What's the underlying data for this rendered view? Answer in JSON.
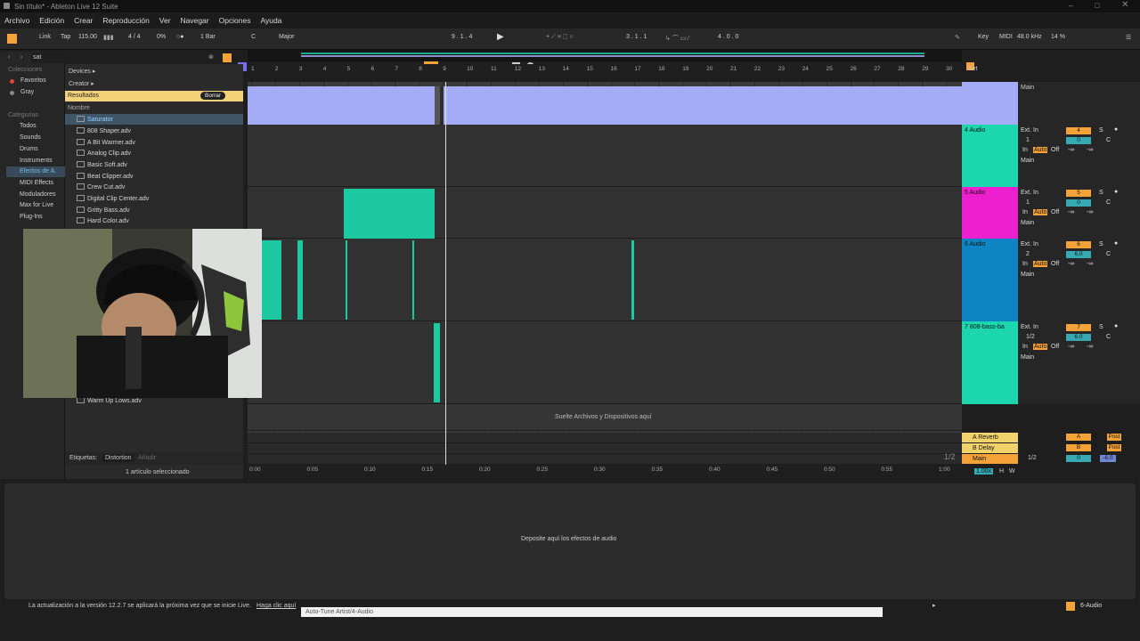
{
  "window": {
    "title": "Sin título* - Ableton Live 12 Suite"
  },
  "menu": [
    "Archivo",
    "Edición",
    "Crear",
    "Reproducción",
    "Ver",
    "Navegar",
    "Opciones",
    "Ayuda"
  ],
  "transport": {
    "link": "Link",
    "tap": "Tap",
    "tempo": "115.00",
    "signature": "4 / 4",
    "metro_pct": "0%",
    "quant": "1 Bar",
    "key": "C",
    "scale": "Major",
    "position": "9 .  1 .  4",
    "loop_start": "3 .  1 .  1",
    "loop_len": "4 .  0 .  0",
    "key_label": "Key",
    "midi_label": "MIDI",
    "sample_rate": "48.0 kHz",
    "cpu": "14 %"
  },
  "browser": {
    "search": "sat",
    "collections_header": "Colecciones",
    "collections": [
      "Favoritos",
      "Gray"
    ],
    "categories_header": "Categorías",
    "categories": [
      "Todos",
      "Sounds",
      "Drums",
      "Instruments",
      "Efectos de A.",
      "MIDI Effects",
      "Moduladores",
      "Max for Live",
      "Plug-Ins"
    ],
    "devices": "Devices ▸",
    "creator": "Creator ▸",
    "results_label": "Resultados",
    "clear_label": "Borrar",
    "name_header": "Nombre",
    "results": [
      "Saturator",
      "808 Shaper.adv",
      "A Bit Warmer.adv",
      "Analog Clip.adv",
      "Basic Soft.adv",
      "Beat Clipper.adv",
      "Crew Cut.adv",
      "Digital Clip Center.adv",
      "Gritty Bass.adv",
      "Hard Color.adv"
    ],
    "last_result": "Warm Up Lows.adv",
    "tags_label": "Etiquetas:",
    "tag": "Distortion",
    "add_tag": "Añadir",
    "selection_info": "1 artículo seleccionado"
  },
  "ruler": [
    "1",
    "2",
    "3",
    "4",
    "5",
    "6",
    "7",
    "8",
    "9",
    "10",
    "11",
    "12",
    "13",
    "14",
    "15",
    "16",
    "17",
    "18",
    "19",
    "20",
    "21",
    "22",
    "23",
    "24",
    "25",
    "26",
    "27",
    "28",
    "29",
    "30"
  ],
  "time_ruler": [
    "0:00",
    "0:05",
    "0:10",
    "0:15",
    "0:20",
    "0:25",
    "0:30",
    "0:35",
    "0:40",
    "0:45",
    "0:50",
    "0:55",
    "1:00"
  ],
  "set_label": "Set",
  "tracks": [
    {
      "name": "4 Audio",
      "color": "#1cd6ae",
      "input": "Ext. In",
      "ch": "1",
      "num": "4",
      "vol": "0",
      "pan": "C"
    },
    {
      "name": "5 Audio",
      "color": "#ee1fcf",
      "input": "Ext. In",
      "ch": "1",
      "num": "5",
      "vol": "0",
      "pan": "C"
    },
    {
      "name": "6 Audio",
      "color": "#0e85c2",
      "input": "Ext. In",
      "ch": "2",
      "num": "6",
      "vol": "6.0",
      "pan": "C"
    },
    {
      "name": "7 808-bass-ba",
      "color": "#1cd6ae",
      "input": "Ext. In",
      "ch": "1/2",
      "num": "7",
      "vol": "6.0",
      "pan": "C"
    }
  ],
  "monitor": {
    "in": "In",
    "auto": "Auto",
    "off": "Off",
    "out": "Main",
    "inf": "-∞"
  },
  "returns": [
    {
      "name": "A Reverb",
      "letter": "A",
      "post": "Post"
    },
    {
      "name": "B Delay",
      "letter": "B",
      "post": "Post"
    },
    {
      "name": "Main",
      "letter": "",
      "post": "Post"
    }
  ],
  "main_in": "1/2",
  "main_vol": "0",
  "main_pan": "-6.0",
  "drop_files": "Suelte Archivos y Dispositivos aquí",
  "drop_effects": "Deposite aquí los efectos de audio",
  "fraction": "1/2",
  "zoom": "1.00x",
  "h_label": "H",
  "w_label": "W",
  "status": {
    "message": "La actualización a la versión 12.2.7 se aplicará la próxima vez que se inicie Live.",
    "link": "Haga clic aquí",
    "plugin": "Auto-Tune Artist/4-Audio",
    "selected_track": "6-Audio"
  }
}
